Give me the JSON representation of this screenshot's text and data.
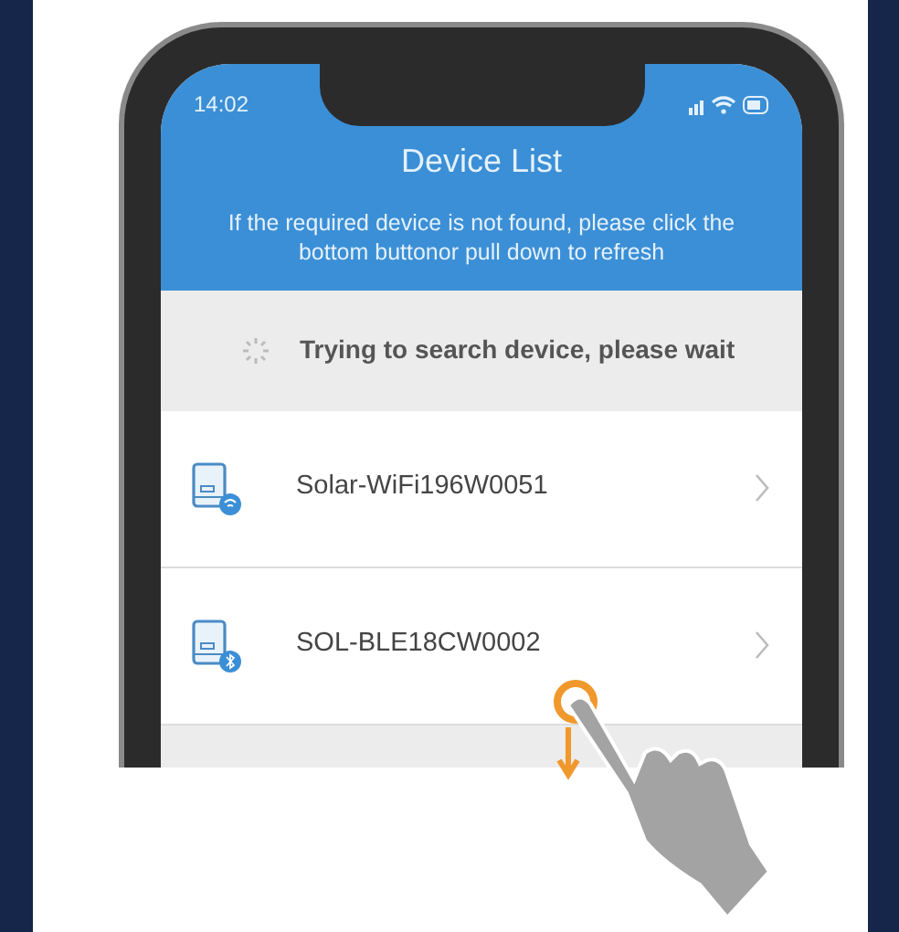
{
  "status_bar": {
    "time": "14:02"
  },
  "header": {
    "title": "Device List",
    "message": "If the required device is not found, please click the bottom buttonor pull down to refresh"
  },
  "search_status": {
    "text": "Trying to search device, please wait"
  },
  "devices": [
    {
      "name": "Solar-WiFi196W0051",
      "kind": "wifi"
    },
    {
      "name": "SOL-BLE18CW0002",
      "kind": "bluetooth"
    }
  ]
}
